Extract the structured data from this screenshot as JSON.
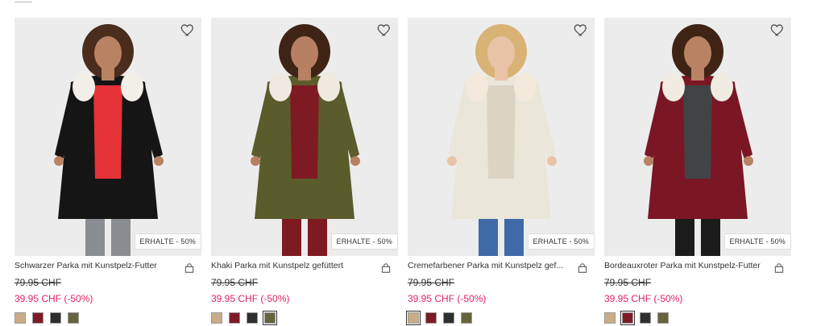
{
  "products": [
    {
      "title": "Schwarzer Parka mit Kunstpelz-Futter",
      "old_price": "79.95 CHF",
      "new_price": "39.95 CHF (-50%)",
      "badge": "ERHALTE - 50%",
      "coat_color": "#151515",
      "inner_color": "#e53236",
      "fur_color": "#f2efe9",
      "pants_color": "#8a8d92",
      "hair_color": "#4a2d1c",
      "skin_color": "#b98263",
      "selected_swatch": -1,
      "swatches": [
        "#c9ad86",
        "#7f1a27",
        "#2d2f30",
        "#66643c"
      ]
    },
    {
      "title": "Khaki Parka mit Kunstpelz gefüttert",
      "old_price": "79.95 CHF",
      "new_price": "39.95 CHF (-50%)",
      "badge": "ERHALTE - 50%",
      "coat_color": "#5a5c2b",
      "inner_color": "#7e1b22",
      "fur_color": "#efe9df",
      "pants_color": "#7e1b22",
      "hair_color": "#3f2416",
      "skin_color": "#b78062",
      "selected_swatch": 3,
      "swatches": [
        "#c9ad86",
        "#7f1a27",
        "#2d2f30",
        "#66643c"
      ]
    },
    {
      "title": "Cremefarbener Parka mit Kunstpelz gef...",
      "old_price": "79.95 CHF",
      "new_price": "39.95 CHF (-50%)",
      "badge": "ERHALTE - 50%",
      "coat_color": "#ebe6da",
      "inner_color": "#dcd4c2",
      "fur_color": "#f3eadb",
      "pants_color": "#3f6aa8",
      "hair_color": "#d9b276",
      "skin_color": "#e9c3a7",
      "selected_swatch": 0,
      "swatches": [
        "#c9ad86",
        "#7f1a27",
        "#2d2f30",
        "#66643c"
      ]
    },
    {
      "title": "Bordeauxroter Parka mit Kunstpelz-Futter",
      "old_price": "79.95 CHF",
      "new_price": "39.95 CHF (-50%)",
      "badge": "ERHALTE - 50%",
      "coat_color": "#7b1624",
      "inner_color": "#414447",
      "fur_color": "#f1ece2",
      "pants_color": "#1b1b1b",
      "hair_color": "#3f2416",
      "skin_color": "#b98263",
      "selected_swatch": 1,
      "swatches": [
        "#c9ad86",
        "#7f1a27",
        "#2d2f30",
        "#66643c"
      ]
    }
  ],
  "icons": {
    "wishlist": "heart-icon",
    "cart": "shopping-bag-icon"
  }
}
